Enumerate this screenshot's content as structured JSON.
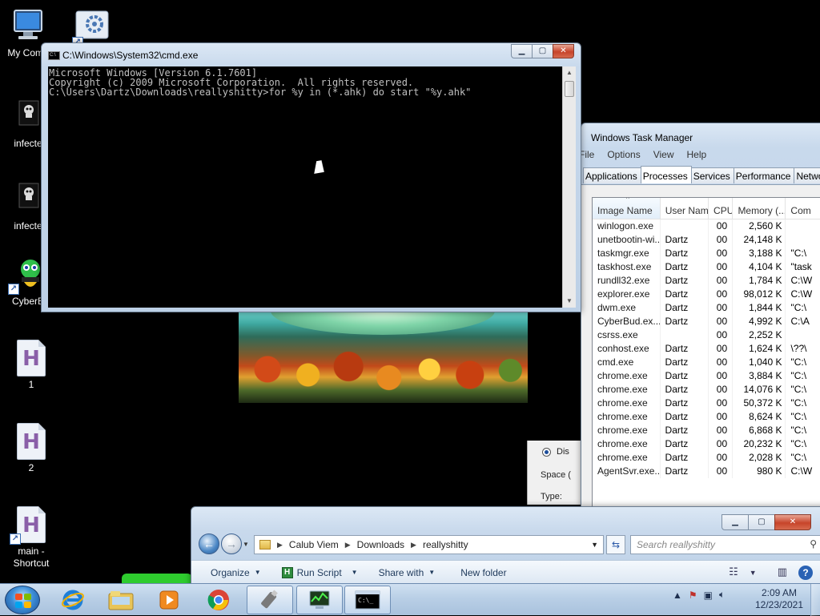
{
  "desktop": {
    "icons": [
      {
        "label": "My Comp"
      },
      {
        "label": ""
      },
      {
        "label": "infecte"
      },
      {
        "label": "infecte"
      },
      {
        "label": "CyberB"
      },
      {
        "label": "1",
        "glyph": "H"
      },
      {
        "label": "2",
        "glyph": "H"
      },
      {
        "label": "main -\nShortcut",
        "glyph": "H"
      }
    ]
  },
  "cmd": {
    "title": "C:\\Windows\\System32\\cmd.exe",
    "icon_text": "C:\\",
    "lines": [
      "Microsoft Windows [Version 6.1.7601]",
      "Copyright (c) 2009 Microsoft Corporation.  All rights reserved.",
      "",
      "C:\\Users\\Dartz\\Downloads\\reallyshitty>for %y in (*.ahk) do start \"%y.ahk\""
    ]
  },
  "taskmgr": {
    "title": "Windows Task Manager",
    "menu": [
      "File",
      "Options",
      "View",
      "Help"
    ],
    "tabs": [
      "Applications",
      "Processes",
      "Services",
      "Performance",
      "Networki"
    ],
    "active_tab": "Processes",
    "columns": [
      "Image Name",
      "User Name",
      "CPU",
      "Memory (...",
      "Com"
    ],
    "rows": [
      {
        "name": "winlogon.exe",
        "user": "",
        "cpu": "00",
        "mem": "2,560 K",
        "cmd": ""
      },
      {
        "name": "unetbootin-wi...",
        "user": "Dartz",
        "cpu": "00",
        "mem": "24,148 K",
        "cmd": ""
      },
      {
        "name": "taskmgr.exe",
        "user": "Dartz",
        "cpu": "00",
        "mem": "3,188 K",
        "cmd": "\"C:\\"
      },
      {
        "name": "taskhost.exe",
        "user": "Dartz",
        "cpu": "00",
        "mem": "4,104 K",
        "cmd": "\"task"
      },
      {
        "name": "rundll32.exe",
        "user": "Dartz",
        "cpu": "00",
        "mem": "1,784 K",
        "cmd": "C:\\W"
      },
      {
        "name": "explorer.exe",
        "user": "Dartz",
        "cpu": "00",
        "mem": "98,012 K",
        "cmd": "C:\\W"
      },
      {
        "name": "dwm.exe",
        "user": "Dartz",
        "cpu": "00",
        "mem": "1,844 K",
        "cmd": "\"C:\\"
      },
      {
        "name": "CyberBud.ex...",
        "user": "Dartz",
        "cpu": "00",
        "mem": "4,992 K",
        "cmd": "C:\\A"
      },
      {
        "name": "csrss.exe",
        "user": "",
        "cpu": "00",
        "mem": "2,252 K",
        "cmd": ""
      },
      {
        "name": "conhost.exe",
        "user": "Dartz",
        "cpu": "00",
        "mem": "1,624 K",
        "cmd": "\\??\\"
      },
      {
        "name": "cmd.exe",
        "user": "Dartz",
        "cpu": "00",
        "mem": "1,040 K",
        "cmd": "\"C:\\"
      },
      {
        "name": "chrome.exe",
        "user": "Dartz",
        "cpu": "00",
        "mem": "3,884 K",
        "cmd": "\"C:\\"
      },
      {
        "name": "chrome.exe",
        "user": "Dartz",
        "cpu": "00",
        "mem": "14,076 K",
        "cmd": "\"C:\\"
      },
      {
        "name": "chrome.exe",
        "user": "Dartz",
        "cpu": "00",
        "mem": "50,372 K",
        "cmd": "\"C:\\"
      },
      {
        "name": "chrome.exe",
        "user": "Dartz",
        "cpu": "00",
        "mem": "8,624 K",
        "cmd": "\"C:\\"
      },
      {
        "name": "chrome.exe",
        "user": "Dartz",
        "cpu": "00",
        "mem": "6,868 K",
        "cmd": "\"C:\\"
      },
      {
        "name": "chrome.exe",
        "user": "Dartz",
        "cpu": "00",
        "mem": "20,232 K",
        "cmd": "\"C:\\"
      },
      {
        "name": "chrome.exe",
        "user": "Dartz",
        "cpu": "00",
        "mem": "2,028 K",
        "cmd": "\"C:\\"
      },
      {
        "name": "AgentSvr.exe...",
        "user": "Dartz",
        "cpu": "00",
        "mem": "980 K",
        "cmd": "C:\\W"
      }
    ]
  },
  "propdlg": {
    "radio_label": "Dis",
    "space_label": "Space (",
    "type_label": "Type:"
  },
  "explorer": {
    "breadcrumb": [
      "Calub Viem",
      "Downloads",
      "reallyshitty"
    ],
    "search_placeholder": "Search reallyshitty",
    "commands": [
      "Organize",
      "Run Script",
      "Share with",
      "New folder"
    ]
  },
  "taskbar": {
    "time": "2:09 AM",
    "date": "12/23/2021",
    "pinned": [
      "internet-explorer",
      "file-explorer",
      "media-player",
      "chrome",
      "usb-tool",
      "task-manager",
      "cmd"
    ]
  }
}
